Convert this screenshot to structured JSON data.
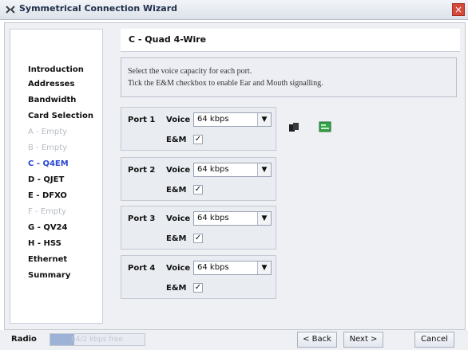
{
  "window": {
    "title": "Symmetrical Connection Wizard"
  },
  "sidebar": {
    "items": [
      {
        "label": "Introduction",
        "state": "normal"
      },
      {
        "label": "Addresses",
        "state": "normal"
      },
      {
        "label": "Bandwidth",
        "state": "normal"
      },
      {
        "label": "Card Selection",
        "state": "normal"
      },
      {
        "label": "A - Empty",
        "state": "disabled"
      },
      {
        "label": "B - Empty",
        "state": "disabled"
      },
      {
        "label": "C - Q4EM",
        "state": "active"
      },
      {
        "label": "D - QJET",
        "state": "normal"
      },
      {
        "label": "E - DFXO",
        "state": "normal"
      },
      {
        "label": "F - Empty",
        "state": "disabled"
      },
      {
        "label": "G - QV24",
        "state": "normal"
      },
      {
        "label": "H - HSS",
        "state": "normal"
      },
      {
        "label": "Ethernet",
        "state": "normal"
      },
      {
        "label": "Summary",
        "state": "normal"
      }
    ]
  },
  "content": {
    "title": "C - Quad 4-Wire",
    "instructions": [
      "Select the voice capacity for each port.",
      "Tick the E&M checkbox to enable Ear and Mouth signalling."
    ],
    "ports": [
      {
        "label": "Port 1",
        "voice_label": "Voice",
        "voice_value": "64 kbps",
        "em_label": "E&M",
        "em_checked": "✓"
      },
      {
        "label": "Port 2",
        "voice_label": "Voice",
        "voice_value": "64 kbps",
        "em_label": "E&M",
        "em_checked": "✓"
      },
      {
        "label": "Port 3",
        "voice_label": "Voice",
        "voice_value": "64 kbps",
        "em_label": "E&M",
        "em_checked": "✓"
      },
      {
        "label": "Port 4",
        "voice_label": "Voice",
        "voice_value": "64 kbps",
        "em_label": "E&M",
        "em_checked": "✓"
      }
    ]
  },
  "bottom": {
    "radio_label": "Radio",
    "radio_text": "64/2 kbps free",
    "radio_fill_fraction": 0.25,
    "back_label": "< Back",
    "next_label": "Next >",
    "cancel_label": "Cancel"
  },
  "icons": {
    "app": "connection-wizard-icon",
    "close": "close-icon",
    "copy": "copy-icon",
    "card": "card-icon",
    "dropdown": "chevron-down-icon"
  }
}
